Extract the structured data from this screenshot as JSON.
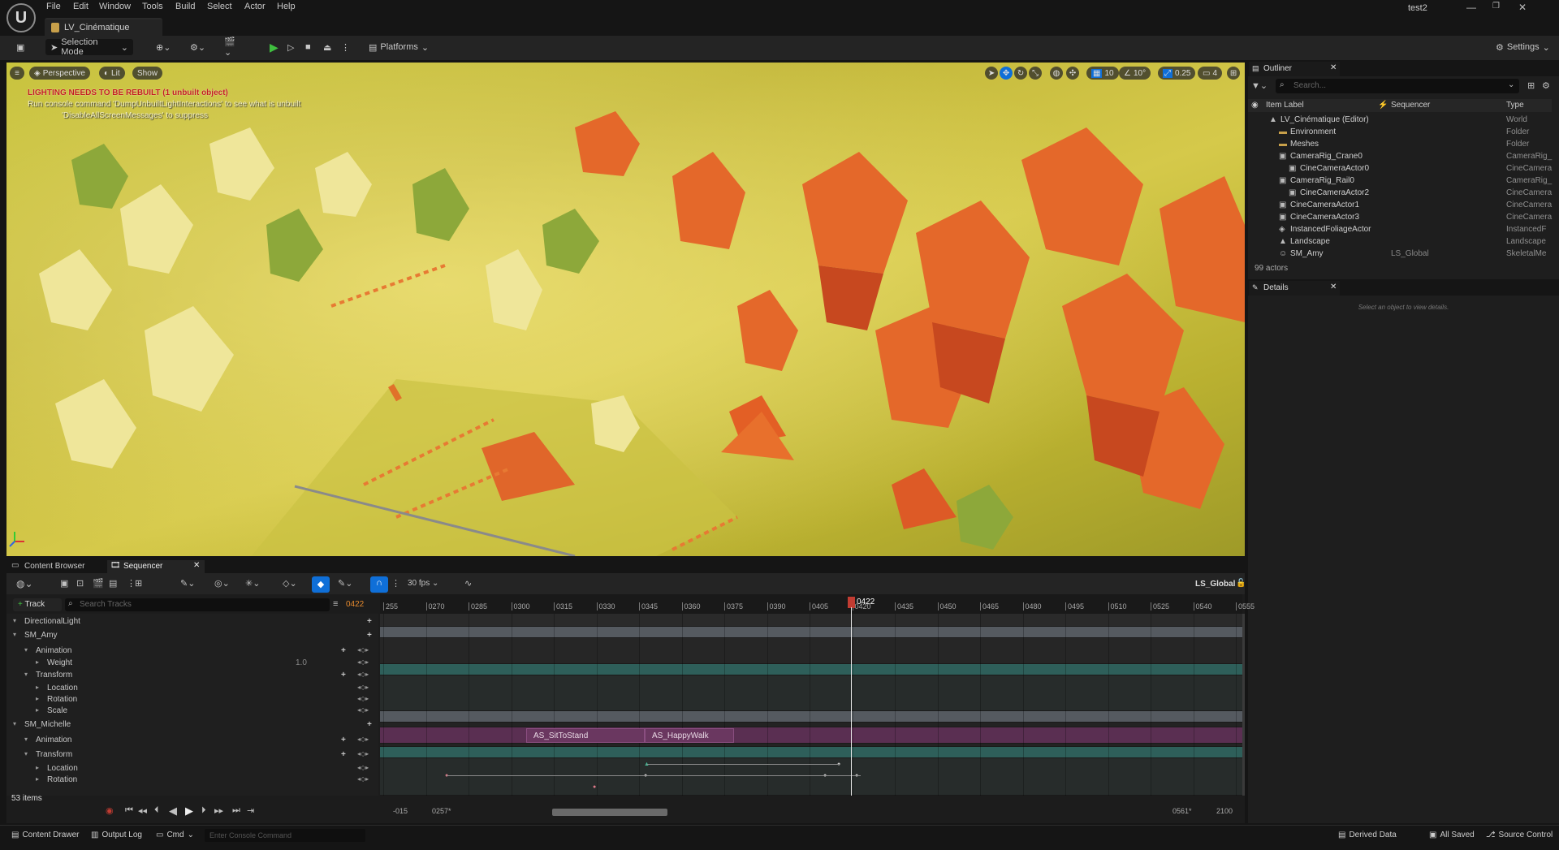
{
  "menu": {
    "items": [
      "File",
      "Edit",
      "Window",
      "Tools",
      "Build",
      "Select",
      "Actor",
      "Help"
    ],
    "project": "test2",
    "level_tab": "LV_Cinématique"
  },
  "toolbar": {
    "mode": "Selection Mode",
    "platforms": "Platforms",
    "settings": "Settings"
  },
  "viewport": {
    "perspective": "Perspective",
    "lit": "Lit",
    "show": "Show",
    "warning_title": "LIGHTING NEEDS TO BE REBUILT (1 unbuilt object)",
    "warning_line": "Run console command 'DumpUnbuiltLightInteractions' to see what is unbuilt",
    "warning_suppress": "'DisableAllScreenMessages' to suppress",
    "grid_snap": "10",
    "rot_snap": "10°",
    "scale_snap": "0.25",
    "cam_speed": "4"
  },
  "outliner": {
    "tab": "Outliner",
    "search_placeholder": "Search...",
    "col_label": "Item Label",
    "col_sequencer": "Sequencer",
    "col_type": "Type",
    "rows": [
      {
        "name": "LV_Cinématique (Editor)",
        "type": "World",
        "seq": ""
      },
      {
        "name": "Environment",
        "type": "Folder",
        "seq": ""
      },
      {
        "name": "Meshes",
        "type": "Folder",
        "seq": ""
      },
      {
        "name": "CameraRig_Crane0",
        "type": "CameraRig_",
        "seq": ""
      },
      {
        "name": "CineCameraActor0",
        "type": "CineCamera",
        "seq": ""
      },
      {
        "name": "CameraRig_Rail0",
        "type": "CameraRig_",
        "seq": ""
      },
      {
        "name": "CineCameraActor2",
        "type": "CineCamera",
        "seq": ""
      },
      {
        "name": "CineCameraActor1",
        "type": "CineCamera",
        "seq": ""
      },
      {
        "name": "CineCameraActor3",
        "type": "CineCamera",
        "seq": ""
      },
      {
        "name": "InstancedFoliageActor",
        "type": "InstancedF",
        "seq": ""
      },
      {
        "name": "Landscape",
        "type": "Landscape",
        "seq": ""
      },
      {
        "name": "SM_Amy",
        "type": "SkeletalMe",
        "seq": "LS_Global"
      }
    ],
    "count": "99 actors"
  },
  "details": {
    "tab": "Details",
    "empty": "Select an object to view details."
  },
  "bottom_tabs": {
    "content_browser": "Content Browser",
    "sequencer": "Sequencer"
  },
  "sequencer": {
    "fps": "30 fps",
    "sequence_name": "LS_Global",
    "add_track": "Track",
    "search_placeholder": "Search Tracks",
    "current_frame": "0422",
    "playhead_label": "0422",
    "tracks": [
      {
        "label": "DirectionalLight",
        "indent": 0
      },
      {
        "label": "SM_Amy",
        "indent": 0
      },
      {
        "label": "Animation",
        "indent": 1
      },
      {
        "label": "Weight",
        "indent": 2,
        "value": "1.0"
      },
      {
        "label": "Transform",
        "indent": 1
      },
      {
        "label": "Location",
        "indent": 2
      },
      {
        "label": "Rotation",
        "indent": 2
      },
      {
        "label": "Scale",
        "indent": 2
      },
      {
        "label": "SM_Michelle",
        "indent": 0
      },
      {
        "label": "Animation",
        "indent": 1
      },
      {
        "label": "Transform",
        "indent": 1
      },
      {
        "label": "Location",
        "indent": 2
      },
      {
        "label": "Rotation",
        "indent": 2
      }
    ],
    "items_count": "53 items",
    "ruler": [
      "255",
      "0270",
      "0285",
      "0300",
      "0315",
      "0330",
      "0345",
      "0360",
      "0375",
      "0390",
      "0405",
      "0420",
      "0435",
      "0450",
      "0465",
      "0480",
      "0495",
      "0510",
      "0525",
      "0540",
      "0555"
    ],
    "clips": [
      "AS_SitToStand",
      "AS_HappyWalk"
    ],
    "range_start": "-015",
    "view_start": "0257*",
    "view_end": "0561*",
    "range_end": "2100"
  },
  "statusbar": {
    "content_drawer": "Content Drawer",
    "output_log": "Output Log",
    "cmd": "Cmd",
    "console_placeholder": "Enter Console Command",
    "derived_data": "Derived Data",
    "all_saved": "All Saved",
    "source_control": "Source Control"
  },
  "colors": {
    "accent_blue": "#0f6fd8",
    "play_green": "#3fbf3f",
    "warning_red": "#c41e1e",
    "clip_purple": "#5a2f52",
    "transform_teal": "#2e5f5a",
    "playhead_red": "#c13c32"
  }
}
